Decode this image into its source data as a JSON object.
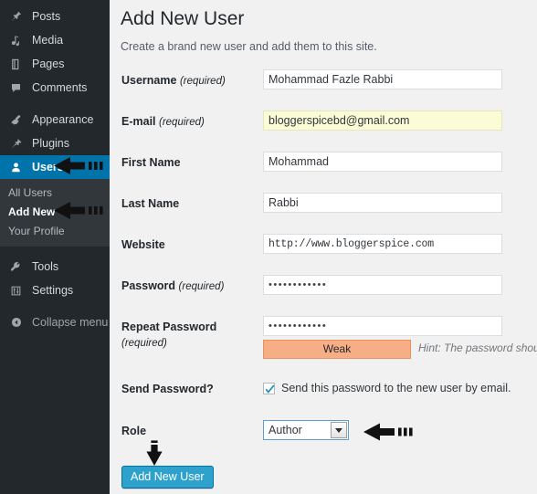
{
  "sidebar": {
    "items": [
      {
        "label": "Posts",
        "icon": "pin-icon",
        "state": "normal"
      },
      {
        "label": "Media",
        "icon": "media-icon",
        "state": "normal"
      },
      {
        "label": "Pages",
        "icon": "page-icon",
        "state": "normal"
      },
      {
        "label": "Comments",
        "icon": "comment-icon",
        "state": "normal"
      },
      {
        "label": "Appearance",
        "icon": "paintbrush-icon",
        "state": "normal"
      },
      {
        "label": "Plugins",
        "icon": "plug-icon",
        "state": "normal"
      },
      {
        "label": "Users",
        "icon": "user-icon",
        "state": "active"
      },
      {
        "label": "Tools",
        "icon": "wrench-icon",
        "state": "normal"
      },
      {
        "label": "Settings",
        "icon": "sliders-icon",
        "state": "normal"
      }
    ],
    "submenu": [
      {
        "label": "All Users",
        "current": false
      },
      {
        "label": "Add New",
        "current": true
      },
      {
        "label": "Your Profile",
        "current": false
      }
    ],
    "collapse": {
      "label": "Collapse menu",
      "icon": "collapse-arrow-icon"
    },
    "active_color": "#0073aa",
    "background": "#23282d",
    "submenu_background": "#32373c"
  },
  "main": {
    "title": "Add New User",
    "description": "Create a brand new user and add them to this site.",
    "fields": {
      "username": {
        "label": "Username",
        "required_note": "(required)",
        "value": "Mohammad Fazle Rabbi"
      },
      "email": {
        "label": "E-mail",
        "required_note": "(required)",
        "value": "bloggerspicebd@gmail.com",
        "highlight_color": "#fbfbd6"
      },
      "first_name": {
        "label": "First Name",
        "required_note": "",
        "value": "Mohammad"
      },
      "last_name": {
        "label": "Last Name",
        "required_note": "",
        "value": "Rabbi"
      },
      "website": {
        "label": "Website",
        "required_note": "",
        "value": "http://www.bloggerspice.com"
      },
      "password": {
        "label": "Password",
        "required_note": "(required)",
        "value": "••••••••••••"
      },
      "repeat_password": {
        "label": "Repeat Password",
        "required_note": "(required)",
        "value": "••••••••••••"
      },
      "strength": {
        "text": "Weak",
        "color": "#f7ad85",
        "hint": "Hint: The password should "
      },
      "send_password": {
        "label": "Send Password?",
        "checkbox_label": "Send this password to the new user by email.",
        "checked": true
      },
      "role": {
        "label": "Role",
        "value": "Author"
      }
    },
    "submit_button": {
      "label": "Add New User",
      "color": "#2ea2cc"
    }
  },
  "annotations": [
    {
      "name": "arrow-pointing-to-users",
      "direction": "left"
    },
    {
      "name": "arrow-pointing-to-add-new",
      "direction": "left"
    },
    {
      "name": "arrow-pointing-to-role-select",
      "direction": "left"
    },
    {
      "name": "arrow-pointing-to-submit",
      "direction": "down"
    }
  ]
}
